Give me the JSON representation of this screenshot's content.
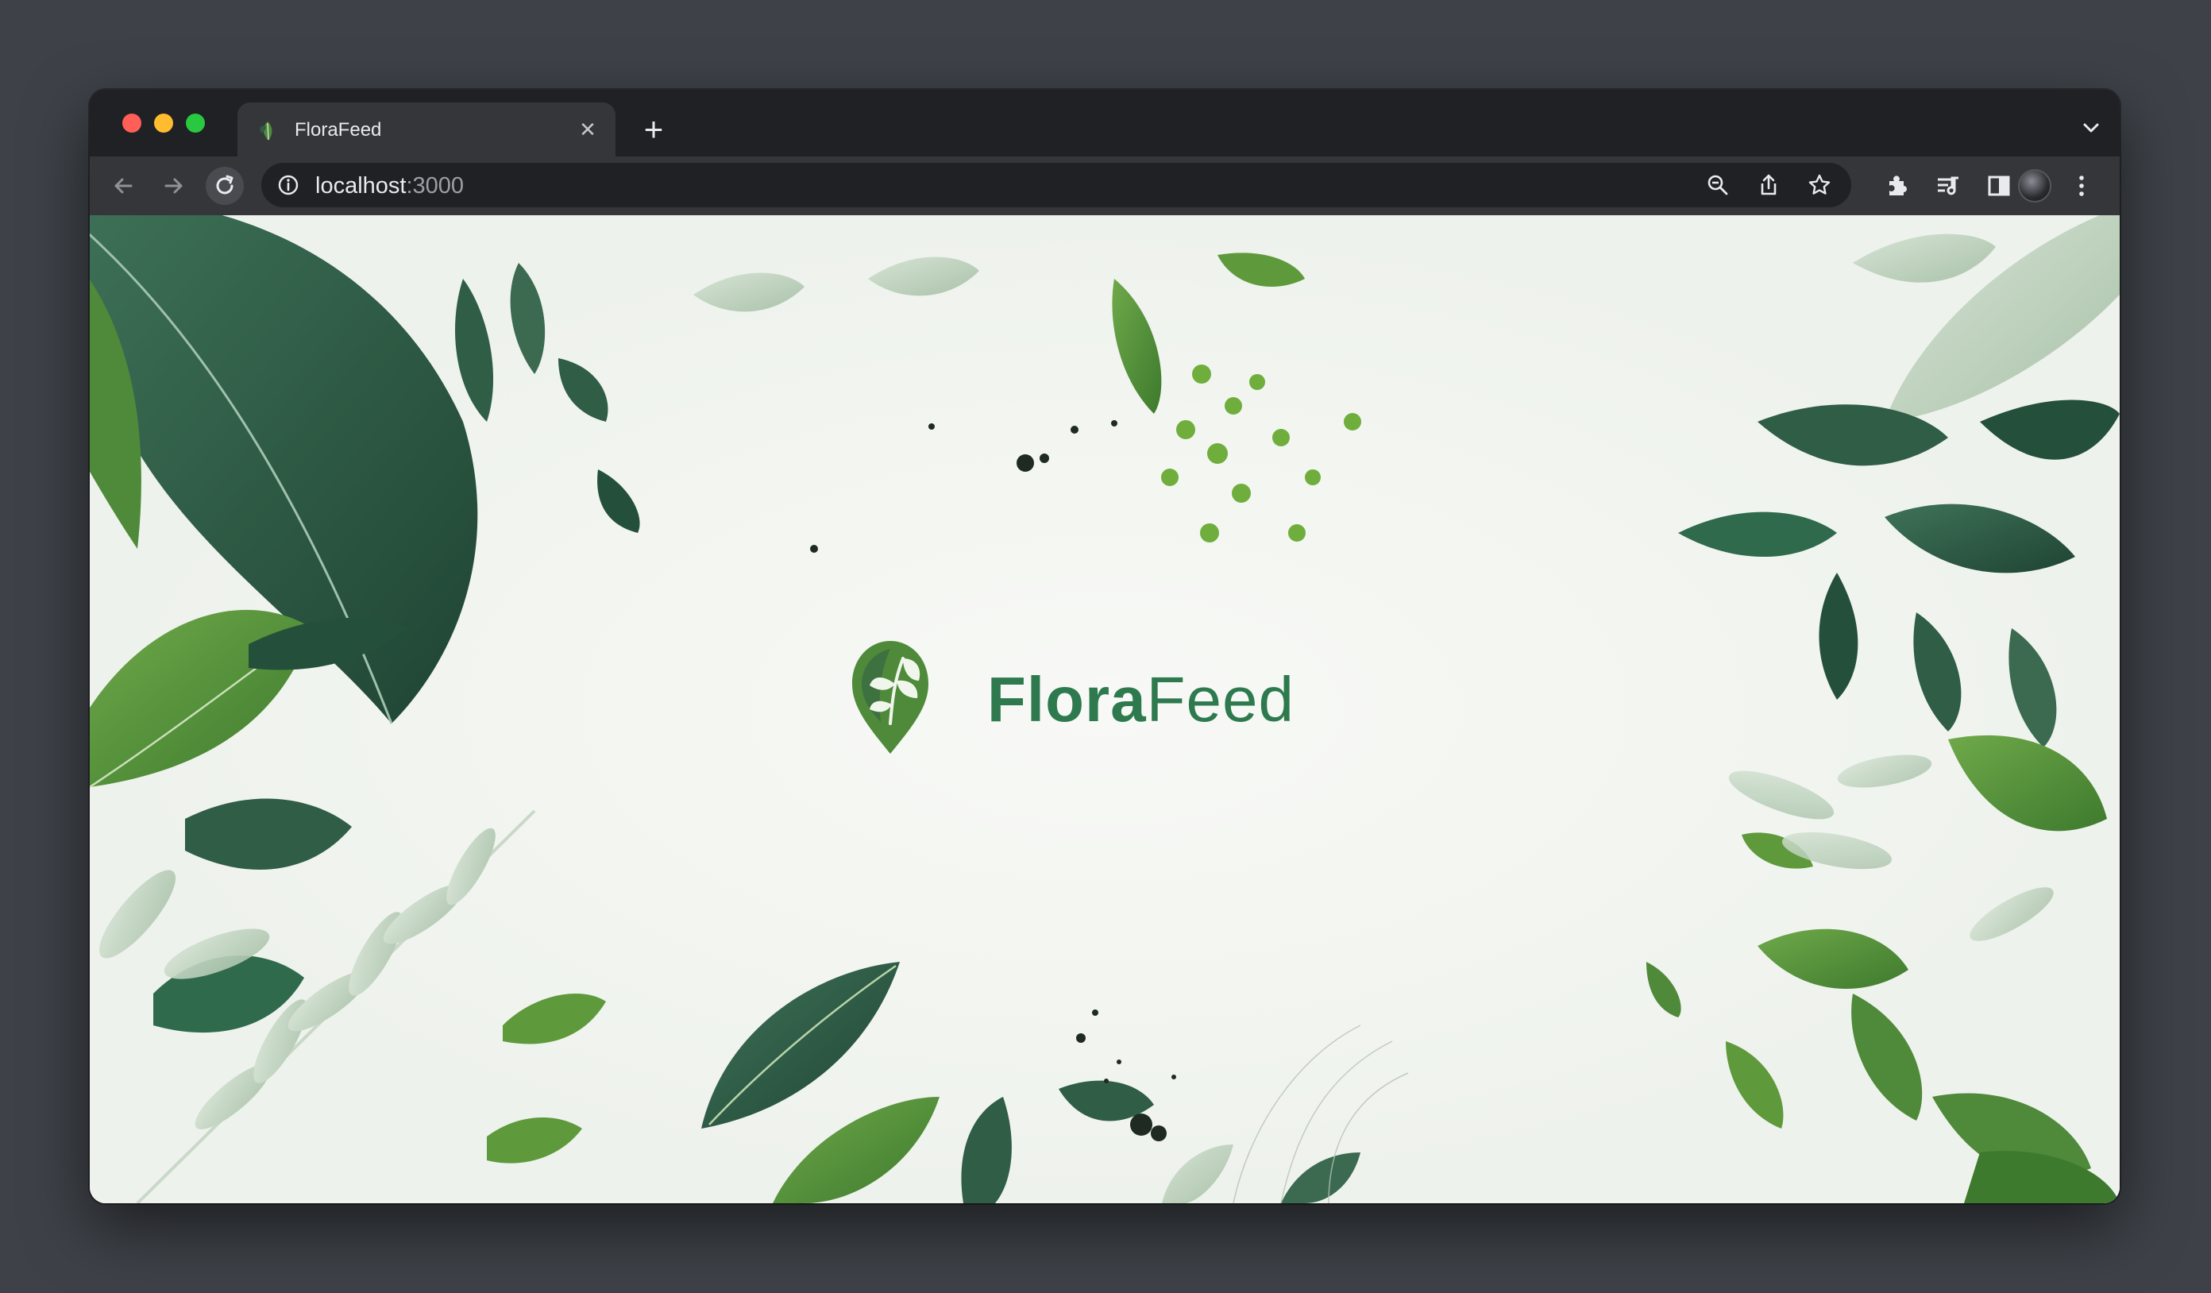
{
  "browser": {
    "tab": {
      "title": "FloraFeed",
      "close_glyph": "✕",
      "favicon": "leaf-icon"
    },
    "new_tab_glyph": "+",
    "address": {
      "host": "localhost",
      "port": ":3000"
    },
    "icons": [
      "back-icon",
      "forward-icon",
      "reload-icon",
      "info-icon",
      "zoom-icon",
      "share-icon",
      "star-icon",
      "extensions-icon",
      "media-icon",
      "sidepanel-icon",
      "profile-avatar",
      "menu-icon",
      "tab-search-icon"
    ]
  },
  "page": {
    "brand": {
      "part1": "Flora",
      "part2": "Feed",
      "logo": "leaf-pin-logo"
    },
    "colors": {
      "brand_green": "#2e7a4e",
      "leaf_dark": "#2f5d45",
      "leaf_mid": "#4f8a3a",
      "leaf_light": "#b9cdb9",
      "background": "#f4f6f1"
    }
  }
}
